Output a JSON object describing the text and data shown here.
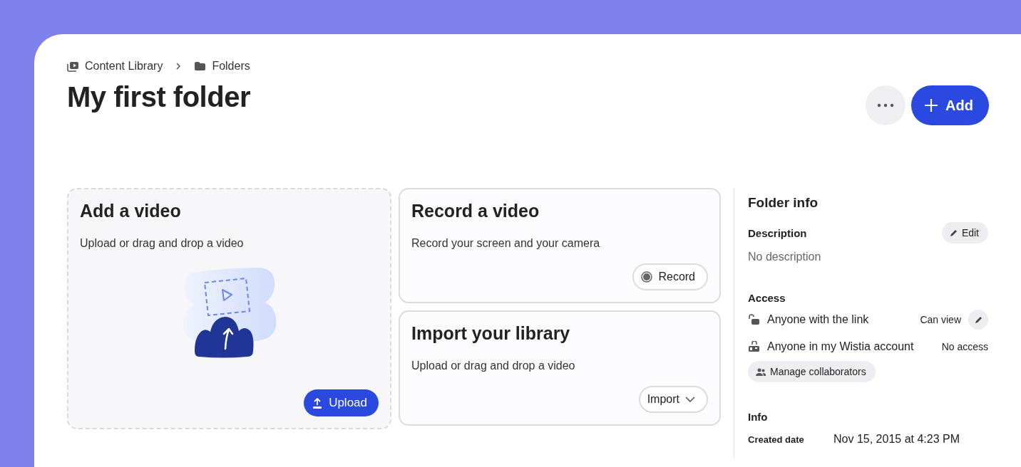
{
  "breadcrumb": [
    {
      "label": "Content Library",
      "kind": "library"
    },
    {
      "label": "Folders",
      "kind": "folder"
    }
  ],
  "title": "My first folder",
  "header_buttons": [
    {
      "kind": "more"
    },
    {
      "kind": "add",
      "label": "Add"
    }
  ],
  "cards": [
    {
      "kind": "upload",
      "title": "Add a video",
      "text": "Upload or drag and drop a video",
      "button": "Upload"
    },
    {
      "kind": "record",
      "title": "Record a video",
      "text": "Record your screen and your camera",
      "button": "Record"
    },
    {
      "kind": "import",
      "title": "Import your library",
      "text": "Upload or drag and drop a video",
      "button": "Import"
    }
  ],
  "folder_info": {
    "title": "Folder info",
    "description_label": "Description",
    "edit_button": "Edit",
    "description": "No description",
    "access_label": "Access",
    "access": [
      {
        "kind": "link",
        "label": "Anyone with the link",
        "permission": "Can view",
        "editable": true
      },
      {
        "kind": "account",
        "label": "Anyone in my Wistia account",
        "permission": "No access",
        "editable": false
      }
    ],
    "manage_button": "Manage collaborators",
    "info_label": "Info",
    "info": [
      {
        "label": "Created date",
        "value": "Nov 15, 2015 at 4:23 PM"
      }
    ]
  }
}
